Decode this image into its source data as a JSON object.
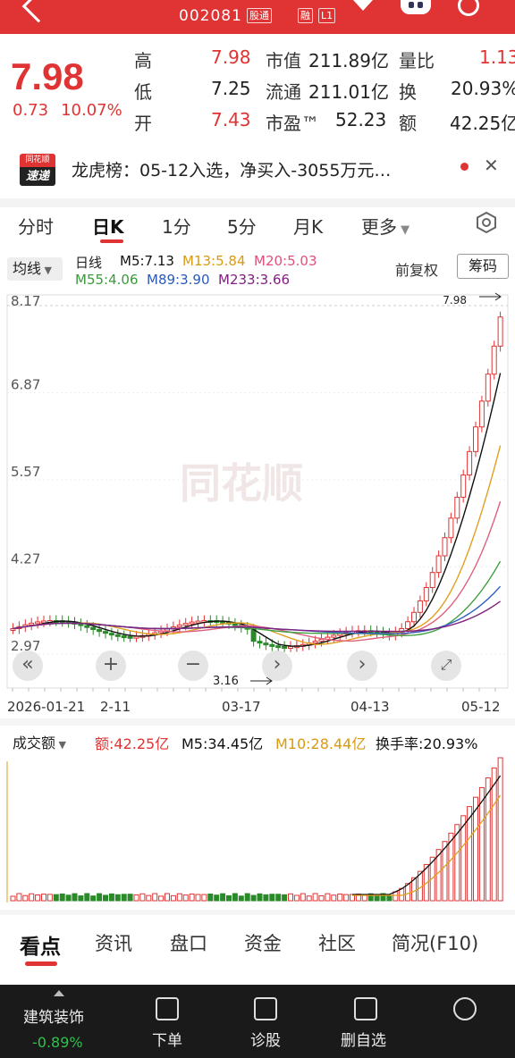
{
  "header": {
    "stock_code": "002081",
    "tag_connect": "股通",
    "tag_margin": "融",
    "tag_level": "L1"
  },
  "quote": {
    "price": "7.98",
    "change": "0.73",
    "change_pct": "10.07%",
    "high_label": "高",
    "high": "7.98",
    "low_label": "低",
    "low": "7.25",
    "open_label": "开",
    "open": "7.43",
    "mktcap_label": "市值",
    "mktcap": "211.89亿",
    "float_label": "流通",
    "float": "211.01亿",
    "pe_label": "市盈™",
    "pe": "52.23",
    "vr_label": "量比",
    "vr": "1.13",
    "turnover_label": "换",
    "turnover": "20.93%",
    "amount_label": "额",
    "amount": "42.25亿"
  },
  "banner": {
    "logo_top": "同花顺",
    "logo_bottom": "速递",
    "text": "龙虎榜：05-12入选，净买入-3055万元…"
  },
  "period_tabs": [
    "分时",
    "日K",
    "1分",
    "5分",
    "月K",
    "更多"
  ],
  "ma_row": {
    "selector": "均线",
    "prefix": "日线",
    "m5": "M5:7.13",
    "m13": "M13:5.84",
    "m20": "M20:5.03",
    "m55": "M55:4.06",
    "m89": "M89:3.90",
    "m233": "M233:3.66",
    "adjust": "前复权",
    "chips": "筹码"
  },
  "colors": {
    "up": "#e03333",
    "down": "#2a8a2a",
    "m5": "#111111",
    "m13": "#e0a020",
    "m20": "#e06080",
    "m55": "#40a040",
    "m89": "#3060c0",
    "m233": "#802080"
  },
  "chart_data": {
    "type": "candlestick",
    "y_ticks": [
      "8.17",
      "6.87",
      "5.57",
      "4.27",
      "2.97"
    ],
    "ylim": [
      2.97,
      8.17
    ],
    "x_ticks": [
      "2026-01-21",
      "2-11",
      "03-17",
      "04-13",
      "05-12"
    ],
    "max_label": "7.98",
    "min_label": "3.16",
    "watermark": "同花顺"
  },
  "volume": {
    "selector": "成交额",
    "amount": "额:42.25亿",
    "m5": "M5:34.45亿",
    "m10": "M10:28.44亿",
    "turnover": "换手率:20.93%"
  },
  "bottom_tabs": [
    "看点",
    "资讯",
    "盘口",
    "资金",
    "社区",
    "简况(F10)"
  ],
  "bottom_bar": {
    "sector": "建筑装饰",
    "sector_chg": "-0.89%",
    "order": "下单",
    "diagnose": "诊股",
    "remove": "删自选"
  }
}
